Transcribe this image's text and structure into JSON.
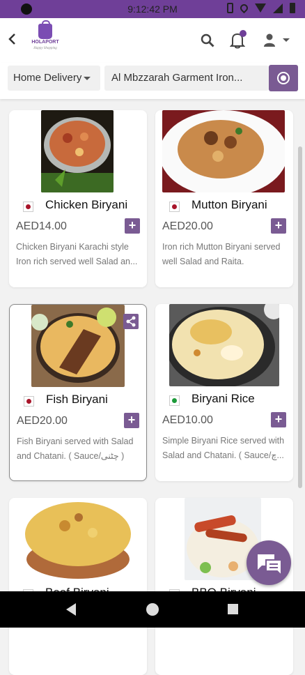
{
  "status": {
    "time": "9:12:42 PM"
  },
  "header": {
    "logo_name": "HOLAPORT",
    "logo_tagline": "Happy Shopping"
  },
  "filters": {
    "delivery_mode": "Home Delivery",
    "location": "Al Mbzzarah Garment Iron..."
  },
  "products": [
    {
      "name": "Chicken Biryani",
      "price": "AED14.00",
      "type": "non-veg",
      "desc": "Chicken Biryani Karachi style Iron rich served well Salad an..."
    },
    {
      "name": "Mutton Biryani",
      "price": "AED20.00",
      "type": "non-veg",
      "desc": "Iron rich Mutton Biryani served well Salad and Raita."
    },
    {
      "name": "Fish Biryani",
      "price": "AED20.00",
      "type": "non-veg",
      "desc": "Fish Biryani served with Salad and Chatani. ( Sauce/چٹنی )"
    },
    {
      "name": "Biryani Rice",
      "price": "AED10.00",
      "type": "veg",
      "desc": "Simple Biryani Rice served with Salad and Chatani. ( Sauce/چ..."
    },
    {
      "name": "Beef Biryani",
      "price": "",
      "type": "non-veg",
      "desc": ""
    },
    {
      "name": "BBQ Biryani",
      "price": "",
      "type": "non-veg",
      "desc": ""
    }
  ],
  "add_label": "+",
  "colors": {
    "brand": "#6f3f98",
    "button": "#7a5b93",
    "nonveg": "#a8152a",
    "veg": "#1d9a3a"
  }
}
